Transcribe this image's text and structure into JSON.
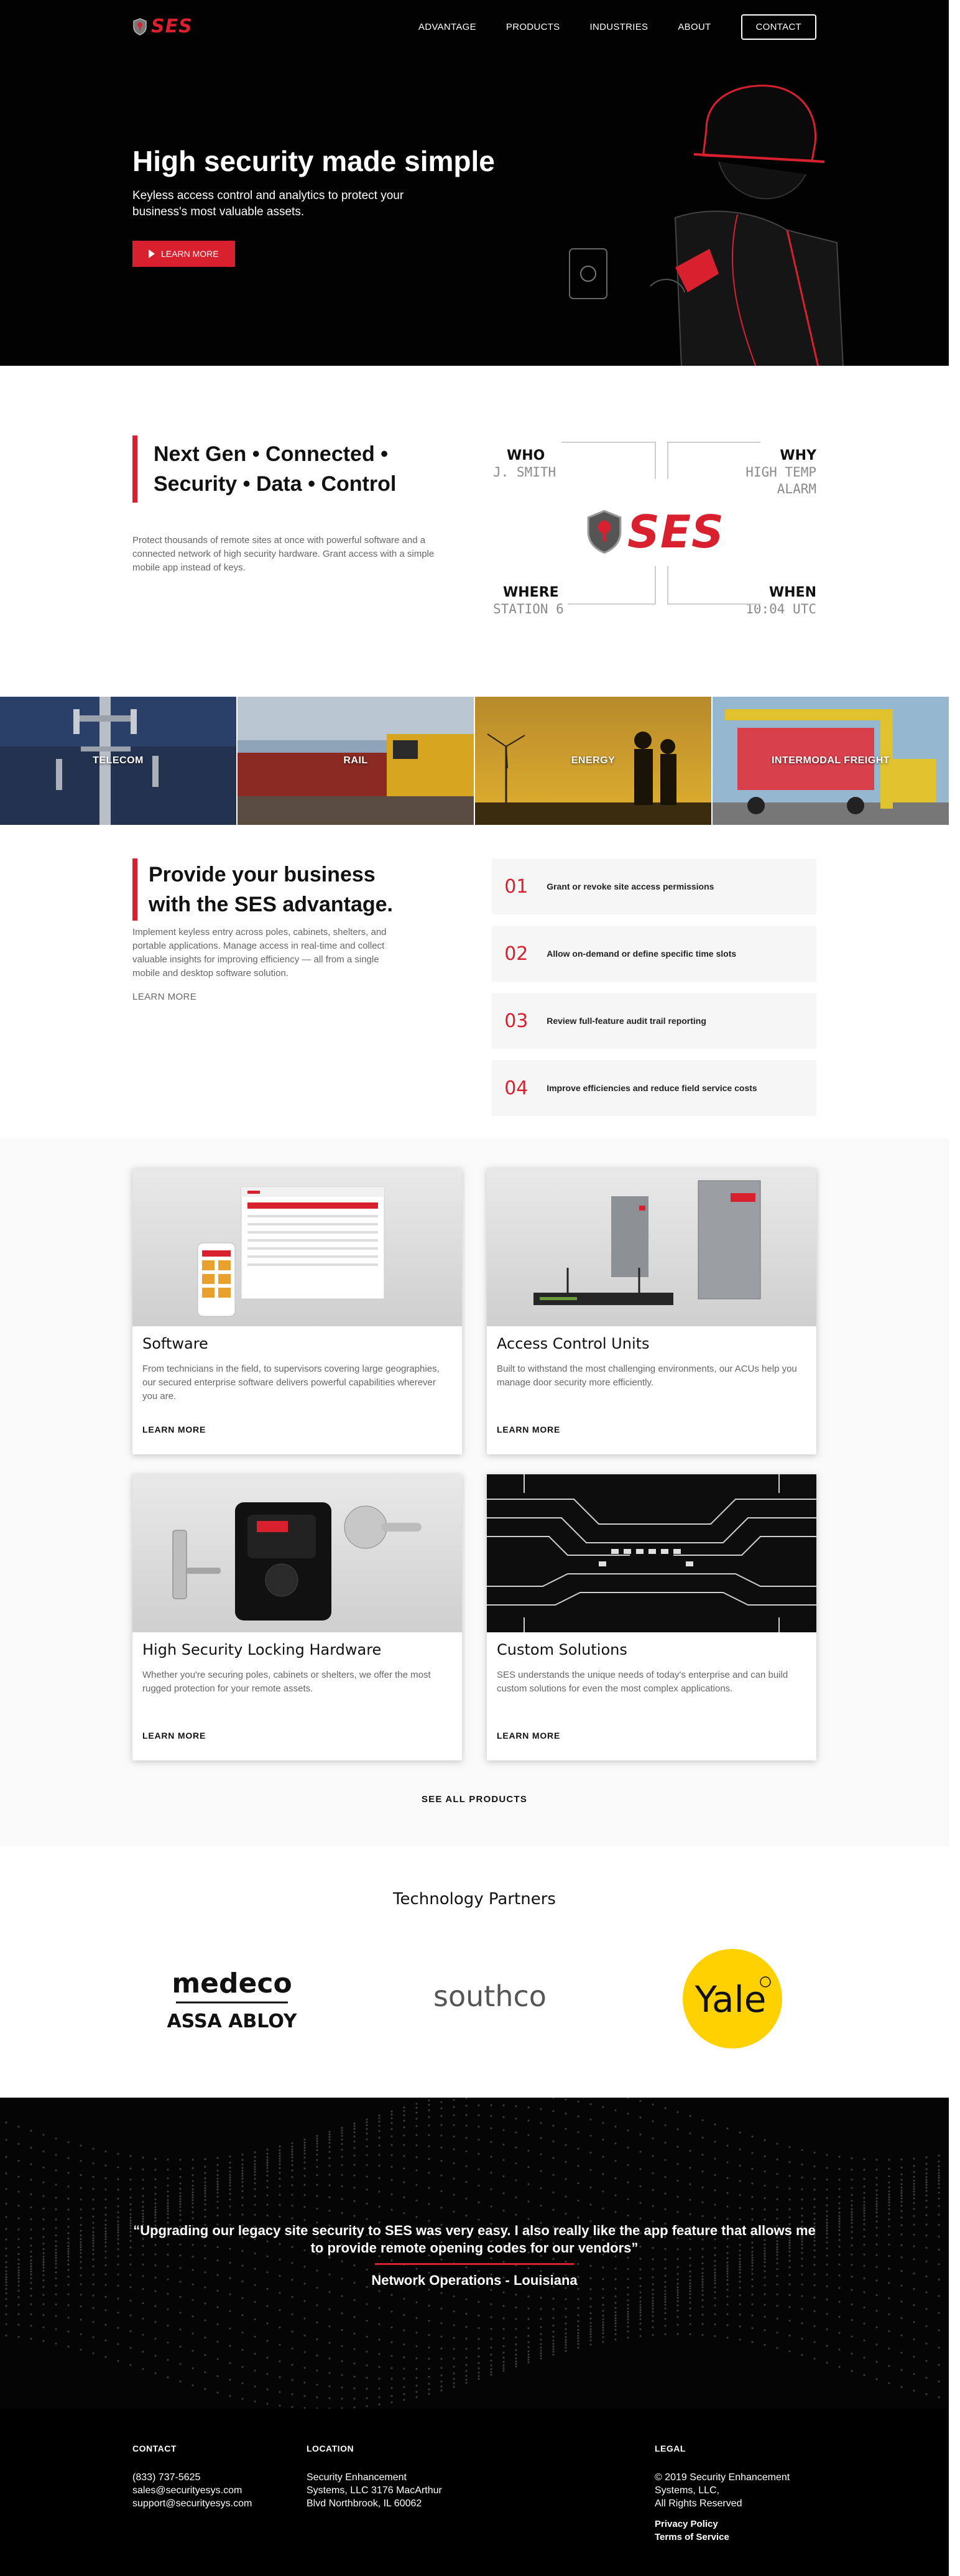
{
  "nav": {
    "logo": "SES",
    "links": [
      "ADVANTAGE",
      "PRODUCTS",
      "INDUSTRIES",
      "ABOUT"
    ],
    "contact": "CONTACT"
  },
  "hero": {
    "title": "High security made simple",
    "subtitle": "Keyless access control and analytics to protect your business's most valuable assets.",
    "cta": "LEARN MORE"
  },
  "intro": {
    "title": "Next Gen • Connected • Security • Data • Control",
    "body": "Protect thousands of remote sites at once with powerful software and a connected network of high security hardware. Grant access with a simple mobile app instead of keys.",
    "diagram": {
      "who_label": "WHO",
      "who_value": "J. SMITH",
      "why_label": "WHY",
      "why_value": "HIGH TEMP ALARM",
      "where_label": "WHERE",
      "where_value": "STATION 6",
      "when_label": "WHEN",
      "when_value": "10:04 UTC",
      "logo": "SES"
    }
  },
  "industries": [
    "TELECOM",
    "RAIL",
    "ENERGY",
    "INTERMODAL FREIGHT"
  ],
  "advantage": {
    "title": "Provide your business with the SES advantage.",
    "body": "Implement keyless entry across poles, cabinets, shelters, and portable applications. Manage access in real-time and collect valuable insights for improving efficiency — all from a single mobile and desktop software solution.",
    "more": "LEARN MORE",
    "items": [
      {
        "num": "01",
        "text": "Grant or revoke site access permissions"
      },
      {
        "num": "02",
        "text": "Allow on-demand or define specific time slots"
      },
      {
        "num": "03",
        "text": "Review full-feature audit trail reporting"
      },
      {
        "num": "04",
        "text": "Improve efficiencies and reduce field service costs"
      }
    ]
  },
  "products": {
    "cards": [
      {
        "title": "Software",
        "body": "From technicians in the field, to supervisors covering large geographies, our secured enterprise software delivers powerful capabilities wherever you are.",
        "more": "LEARN MORE"
      },
      {
        "title": "Access Control Units",
        "body": "Built to withstand the most challenging environments, our ACUs help you manage door security more efficiently.",
        "more": "LEARN MORE"
      },
      {
        "title": "High Security Locking Hardware",
        "body": "Whether you're securing poles, cabinets or shelters, we offer the most rugged protection for your remote assets.",
        "more": "LEARN MORE"
      },
      {
        "title": "Custom Solutions",
        "body": "SES understands the unique needs of today's enterprise and can build custom solutions for even the most complex applications.",
        "more": "LEARN MORE"
      }
    ],
    "see_all": "SEE ALL PRODUCTS"
  },
  "partners": {
    "title": "Technology Partners",
    "medeco": "medeco",
    "assa": "ASSA ABLOY",
    "southco": "southco",
    "yale": "Yale"
  },
  "testimonial": {
    "quote": "“Upgrading our legacy site security to SES was very easy. I also really like the app feature that allows me to provide remote opening codes for our vendors”",
    "author": "Network Operations - Louisiana"
  },
  "footer": {
    "contact_title": "CONTACT",
    "phone": "(833) 737-5625",
    "sales": "sales@securityesys.com",
    "support": "support@securityesys.com",
    "location_title": "LOCATION",
    "location_1": "Security Enhancement",
    "location_2": "Systems, LLC 3176 MacArthur",
    "location_3": "Blvd Northbrook, IL 60062",
    "legal_title": "LEGAL",
    "legal_1": "© 2019 Security Enhancement",
    "legal_2": "Systems, LLC,",
    "legal_3": "All Rights Reserved",
    "privacy": "Privacy Policy",
    "terms": "Terms of Service"
  },
  "colors": {
    "accent": "#d8202e",
    "dark": "#020202",
    "muted": "#666666"
  }
}
